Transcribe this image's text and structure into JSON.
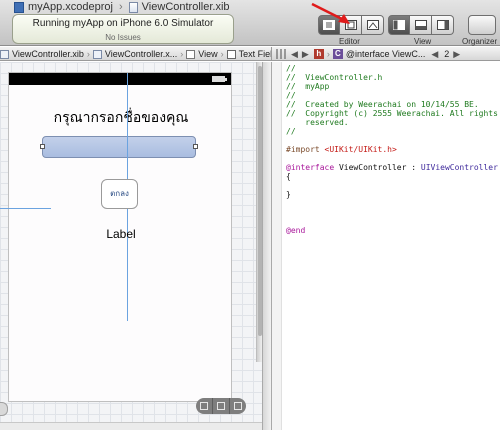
{
  "window": {
    "file_tabs": [
      {
        "label": "myApp.xcodeproj"
      },
      {
        "label": "ViewController.xib"
      }
    ],
    "tab_separator": "›"
  },
  "activity": {
    "status": "Running myApp on iPhone 6.0 Simulator",
    "issues": "No Issues"
  },
  "toolbar": {
    "editor_label": "Editor",
    "view_label": "View",
    "organizer_label": "Organizer"
  },
  "jumpbar": {
    "left_crumbs": [
      "ViewController.xib",
      "ViewController.x...",
      "View",
      "Text Field"
    ],
    "right_crumb": "@interface ViewC...",
    "counter": "2"
  },
  "canvas": {
    "prompt_text": "กรุณากรอกชื่อของคุณ",
    "button_text": "ตกลง",
    "result_label": "Label"
  },
  "code": {
    "lines": [
      {
        "type": "cmt",
        "text": "//"
      },
      {
        "type": "cmt",
        "text": "//  ViewController.h"
      },
      {
        "type": "cmt",
        "text": "//  myApp"
      },
      {
        "type": "cmt",
        "text": "//"
      },
      {
        "type": "cmt",
        "text": "//  Created by Weerachai on 10/14/55 BE."
      },
      {
        "type": "cmt",
        "text": "//  Copyright (c) 2555 Weerachai. All rights"
      },
      {
        "type": "cmt",
        "text": "    reserved."
      },
      {
        "type": "cmt",
        "text": "//"
      },
      {
        "type": "blank",
        "text": ""
      },
      {
        "type": "import",
        "kw": "#import ",
        "str": "<UIKit/UIKit.h>"
      },
      {
        "type": "blank",
        "text": ""
      },
      {
        "type": "iface",
        "kw": "@interface ",
        "name": "ViewController : ",
        "cls": "UIViewController"
      },
      {
        "type": "pln",
        "text": "{"
      },
      {
        "type": "blank",
        "text": ""
      },
      {
        "type": "pln",
        "text": "}"
      },
      {
        "type": "blank",
        "text": ""
      },
      {
        "type": "blank",
        "text": ""
      },
      {
        "type": "blank",
        "text": ""
      },
      {
        "type": "kwline",
        "text": "@end"
      }
    ]
  },
  "colors": {
    "annotation_arrow": "#e01b1b",
    "text_field_fill": "#b6c6e6",
    "guide": "#6ba3e0",
    "comment": "#1f7a1f",
    "keyword": "#a8169a",
    "string": "#c41a16"
  }
}
